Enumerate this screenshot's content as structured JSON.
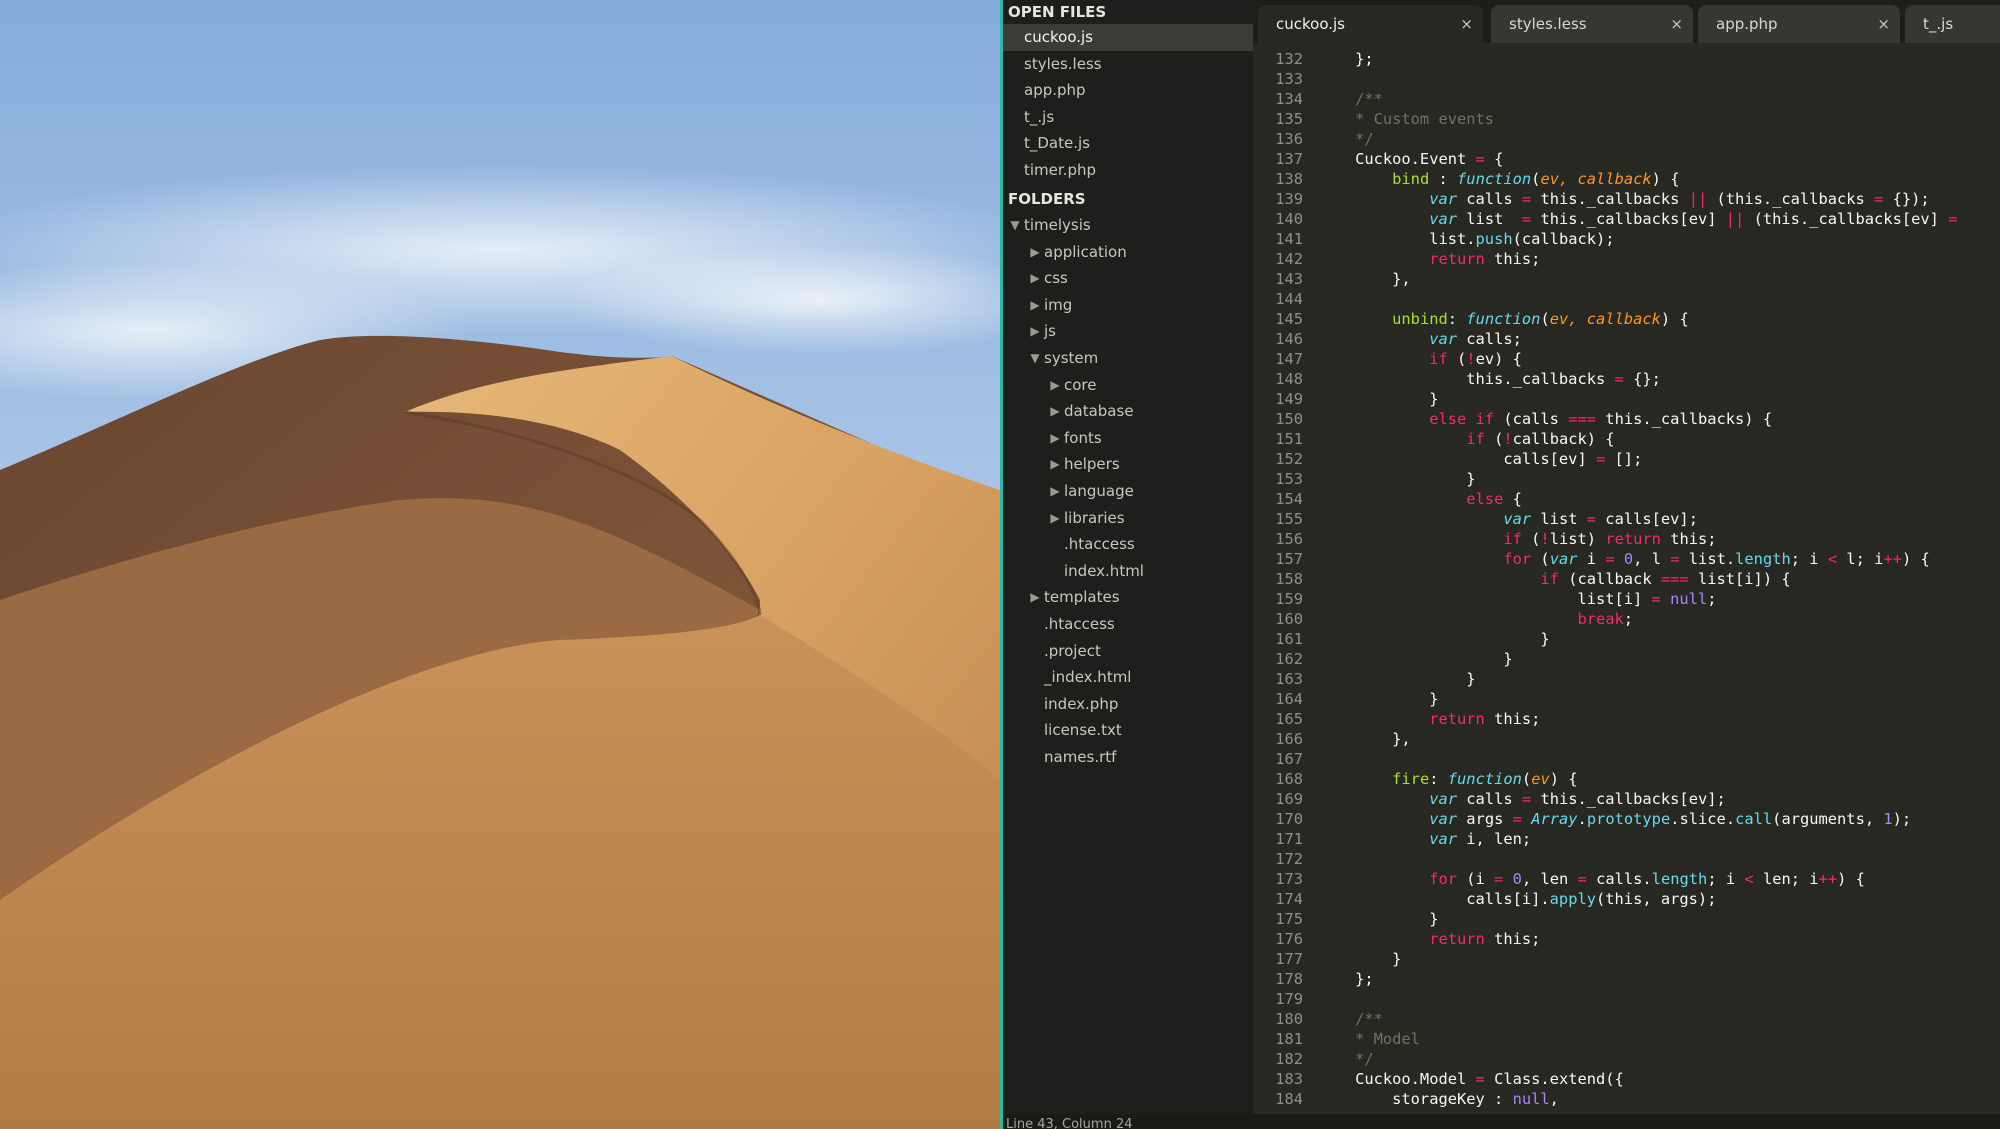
{
  "wallpaper": {
    "description_icon": "desert-dune-wallpaper"
  },
  "sidebar": {
    "open_files_header": "OPEN FILES",
    "open_files": [
      {
        "label": "cuckoo.js",
        "active": true
      },
      {
        "label": "styles.less"
      },
      {
        "label": "app.php"
      },
      {
        "label": "t_.js"
      },
      {
        "label": "t_Date.js"
      },
      {
        "label": "timer.php"
      }
    ],
    "folders_header": "FOLDERS",
    "tree": [
      {
        "label": "timelysis",
        "depth": 0,
        "arrow": "open"
      },
      {
        "label": "application",
        "depth": 1,
        "arrow": "closed"
      },
      {
        "label": "css",
        "depth": 1,
        "arrow": "closed"
      },
      {
        "label": "img",
        "depth": 1,
        "arrow": "closed"
      },
      {
        "label": "js",
        "depth": 1,
        "arrow": "closed"
      },
      {
        "label": "system",
        "depth": 1,
        "arrow": "open"
      },
      {
        "label": "core",
        "depth": 2,
        "arrow": "closed"
      },
      {
        "label": "database",
        "depth": 2,
        "arrow": "closed"
      },
      {
        "label": "fonts",
        "depth": 2,
        "arrow": "closed"
      },
      {
        "label": "helpers",
        "depth": 2,
        "arrow": "closed"
      },
      {
        "label": "language",
        "depth": 2,
        "arrow": "closed"
      },
      {
        "label": "libraries",
        "depth": 2,
        "arrow": "closed"
      },
      {
        "label": ".htaccess",
        "depth": 2,
        "arrow": "none"
      },
      {
        "label": "index.html",
        "depth": 2,
        "arrow": "none"
      },
      {
        "label": "templates",
        "depth": 1,
        "arrow": "closed"
      },
      {
        "label": ".htaccess",
        "depth": 1,
        "arrow": "none"
      },
      {
        "label": ".project",
        "depth": 1,
        "arrow": "none"
      },
      {
        "label": "_index.html",
        "depth": 1,
        "arrow": "none"
      },
      {
        "label": "index.php",
        "depth": 1,
        "arrow": "none"
      },
      {
        "label": "license.txt",
        "depth": 1,
        "arrow": "none"
      },
      {
        "label": "names.rtf",
        "depth": 1,
        "arrow": "none"
      }
    ]
  },
  "tabs": [
    {
      "label": "cuckoo.js",
      "close": "×",
      "active": true
    },
    {
      "label": "styles.less",
      "close": "×"
    },
    {
      "label": "app.php",
      "close": "×"
    },
    {
      "label": "t_.js",
      "close": ""
    }
  ],
  "code_lines": [
    {
      "n": "132",
      "tokens": [
        [
          "    };",
          ""
        ]
      ]
    },
    {
      "n": "133",
      "tokens": []
    },
    {
      "n": "134",
      "tokens": [
        [
          "    /**",
          "cm"
        ]
      ]
    },
    {
      "n": "135",
      "tokens": [
        [
          "    * Custom events",
          "cm"
        ]
      ]
    },
    {
      "n": "136",
      "tokens": [
        [
          "    */",
          "cm"
        ]
      ]
    },
    {
      "n": "137",
      "tokens": [
        [
          "    Cuckoo.Event ",
          ""
        ],
        [
          "=",
          "kw"
        ],
        [
          " {",
          ""
        ]
      ]
    },
    {
      "n": "138",
      "tokens": [
        [
          "        ",
          ""
        ],
        [
          "bind",
          "fn"
        ],
        [
          " : ",
          ""
        ],
        [
          "function",
          "st"
        ],
        [
          "(",
          ""
        ],
        [
          "ev, callback",
          "pa"
        ],
        [
          ") {",
          ""
        ]
      ]
    },
    {
      "n": "139",
      "tokens": [
        [
          "            ",
          ""
        ],
        [
          "var",
          "st"
        ],
        [
          " calls ",
          ""
        ],
        [
          "=",
          "kw"
        ],
        [
          " this._callbacks ",
          ""
        ],
        [
          "||",
          "kw"
        ],
        [
          " (this._callbacks ",
          ""
        ],
        [
          "=",
          "kw"
        ],
        [
          " {});",
          ""
        ]
      ]
    },
    {
      "n": "140",
      "tokens": [
        [
          "            ",
          ""
        ],
        [
          "var",
          "st"
        ],
        [
          " list  ",
          ""
        ],
        [
          "=",
          "kw"
        ],
        [
          " this._callbacks[ev] ",
          ""
        ],
        [
          "||",
          "kw"
        ],
        [
          " (this._callbacks[ev] ",
          ""
        ],
        [
          "=",
          "kw"
        ]
      ]
    },
    {
      "n": "141",
      "tokens": [
        [
          "            list.",
          ""
        ],
        [
          "push",
          "bi"
        ],
        [
          "(callback);",
          ""
        ]
      ]
    },
    {
      "n": "142",
      "tokens": [
        [
          "            ",
          ""
        ],
        [
          "return",
          "kw"
        ],
        [
          " this;",
          ""
        ]
      ]
    },
    {
      "n": "143",
      "tokens": [
        [
          "        },",
          ""
        ]
      ]
    },
    {
      "n": "144",
      "tokens": []
    },
    {
      "n": "145",
      "tokens": [
        [
          "        ",
          ""
        ],
        [
          "unbind",
          "fn"
        ],
        [
          ": ",
          ""
        ],
        [
          "function",
          "st"
        ],
        [
          "(",
          ""
        ],
        [
          "ev, callback",
          "pa"
        ],
        [
          ") {",
          ""
        ]
      ]
    },
    {
      "n": "146",
      "tokens": [
        [
          "            ",
          ""
        ],
        [
          "var",
          "st"
        ],
        [
          " calls;",
          ""
        ]
      ]
    },
    {
      "n": "147",
      "tokens": [
        [
          "            ",
          ""
        ],
        [
          "if",
          "kw"
        ],
        [
          " (",
          ""
        ],
        [
          "!",
          "kw"
        ],
        [
          "ev) {",
          ""
        ]
      ]
    },
    {
      "n": "148",
      "tokens": [
        [
          "                this._callbacks ",
          ""
        ],
        [
          "=",
          "kw"
        ],
        [
          " {};",
          ""
        ]
      ]
    },
    {
      "n": "149",
      "tokens": [
        [
          "            }",
          ""
        ]
      ]
    },
    {
      "n": "150",
      "tokens": [
        [
          "            ",
          ""
        ],
        [
          "else if",
          "kw"
        ],
        [
          " (calls ",
          ""
        ],
        [
          "===",
          "kw"
        ],
        [
          " this._callbacks) {",
          ""
        ]
      ]
    },
    {
      "n": "151",
      "tokens": [
        [
          "                ",
          ""
        ],
        [
          "if",
          "kw"
        ],
        [
          " (",
          ""
        ],
        [
          "!",
          "kw"
        ],
        [
          "callback) {",
          ""
        ]
      ]
    },
    {
      "n": "152",
      "tokens": [
        [
          "                    calls[ev] ",
          ""
        ],
        [
          "=",
          "kw"
        ],
        [
          " [];",
          ""
        ]
      ]
    },
    {
      "n": "153",
      "tokens": [
        [
          "                }",
          ""
        ]
      ]
    },
    {
      "n": "154",
      "tokens": [
        [
          "                ",
          ""
        ],
        [
          "else",
          "kw"
        ],
        [
          " {",
          ""
        ]
      ]
    },
    {
      "n": "155",
      "tokens": [
        [
          "                    ",
          ""
        ],
        [
          "var",
          "st"
        ],
        [
          " list ",
          ""
        ],
        [
          "=",
          "kw"
        ],
        [
          " calls[ev];",
          ""
        ]
      ]
    },
    {
      "n": "156",
      "tokens": [
        [
          "                    ",
          ""
        ],
        [
          "if",
          "kw"
        ],
        [
          " (",
          ""
        ],
        [
          "!",
          "kw"
        ],
        [
          "list) ",
          ""
        ],
        [
          "return",
          "kw"
        ],
        [
          " this;",
          ""
        ]
      ]
    },
    {
      "n": "157",
      "tokens": [
        [
          "                    ",
          ""
        ],
        [
          "for",
          "kw"
        ],
        [
          " (",
          ""
        ],
        [
          "var",
          "st"
        ],
        [
          " i ",
          ""
        ],
        [
          "=",
          "kw"
        ],
        [
          " ",
          ""
        ],
        [
          "0",
          "nu"
        ],
        [
          ", l ",
          ""
        ],
        [
          "=",
          "kw"
        ],
        [
          " list.",
          ""
        ],
        [
          "length",
          "bi"
        ],
        [
          "; i ",
          ""
        ],
        [
          "<",
          "kw"
        ],
        [
          " l; i",
          ""
        ],
        [
          "++",
          "kw"
        ],
        [
          ") {",
          ""
        ]
      ]
    },
    {
      "n": "158",
      "tokens": [
        [
          "                        ",
          ""
        ],
        [
          "if",
          "kw"
        ],
        [
          " (callback ",
          ""
        ],
        [
          "===",
          "kw"
        ],
        [
          " list[i]) {",
          ""
        ]
      ]
    },
    {
      "n": "159",
      "tokens": [
        [
          "                            list[i] ",
          ""
        ],
        [
          "=",
          "kw"
        ],
        [
          " ",
          ""
        ],
        [
          "null",
          "nu"
        ],
        [
          ";",
          ""
        ]
      ]
    },
    {
      "n": "160",
      "tokens": [
        [
          "                            ",
          ""
        ],
        [
          "break",
          "kw"
        ],
        [
          ";",
          ""
        ]
      ]
    },
    {
      "n": "161",
      "tokens": [
        [
          "                        }",
          ""
        ]
      ]
    },
    {
      "n": "162",
      "tokens": [
        [
          "                    }",
          ""
        ]
      ]
    },
    {
      "n": "163",
      "tokens": [
        [
          "                }",
          ""
        ]
      ]
    },
    {
      "n": "164",
      "tokens": [
        [
          "            }",
          ""
        ]
      ]
    },
    {
      "n": "165",
      "tokens": [
        [
          "            ",
          ""
        ],
        [
          "return",
          "kw"
        ],
        [
          " this;",
          ""
        ]
      ]
    },
    {
      "n": "166",
      "tokens": [
        [
          "        },",
          ""
        ]
      ]
    },
    {
      "n": "167",
      "tokens": []
    },
    {
      "n": "168",
      "tokens": [
        [
          "        ",
          ""
        ],
        [
          "fire",
          "fn"
        ],
        [
          ": ",
          ""
        ],
        [
          "function",
          "st"
        ],
        [
          "(",
          ""
        ],
        [
          "ev",
          "pa"
        ],
        [
          ") {",
          ""
        ]
      ]
    },
    {
      "n": "169",
      "tokens": [
        [
          "            ",
          ""
        ],
        [
          "var",
          "st"
        ],
        [
          " calls ",
          ""
        ],
        [
          "=",
          "kw"
        ],
        [
          " this._callbacks[ev];",
          ""
        ]
      ]
    },
    {
      "n": "170",
      "tokens": [
        [
          "            ",
          ""
        ],
        [
          "var",
          "st"
        ],
        [
          " args ",
          ""
        ],
        [
          "=",
          "kw"
        ],
        [
          " ",
          ""
        ],
        [
          "Array",
          "st"
        ],
        [
          ".",
          ""
        ],
        [
          "prototype",
          "bi"
        ],
        [
          ".slice.",
          ""
        ],
        [
          "call",
          "bi"
        ],
        [
          "(arguments, ",
          ""
        ],
        [
          "1",
          "nu"
        ],
        [
          ");",
          ""
        ]
      ]
    },
    {
      "n": "171",
      "tokens": [
        [
          "            ",
          ""
        ],
        [
          "var",
          "st"
        ],
        [
          " i, len;",
          ""
        ]
      ]
    },
    {
      "n": "172",
      "tokens": []
    },
    {
      "n": "173",
      "tokens": [
        [
          "            ",
          ""
        ],
        [
          "for",
          "kw"
        ],
        [
          " (i ",
          ""
        ],
        [
          "=",
          "kw"
        ],
        [
          " ",
          ""
        ],
        [
          "0",
          "nu"
        ],
        [
          ", len ",
          ""
        ],
        [
          "=",
          "kw"
        ],
        [
          " calls.",
          ""
        ],
        [
          "length",
          "bi"
        ],
        [
          "; i ",
          ""
        ],
        [
          "<",
          "kw"
        ],
        [
          " len; i",
          ""
        ],
        [
          "++",
          "kw"
        ],
        [
          ") {",
          ""
        ]
      ]
    },
    {
      "n": "174",
      "tokens": [
        [
          "                calls[i].",
          ""
        ],
        [
          "apply",
          "bi"
        ],
        [
          "(this, args);",
          ""
        ]
      ]
    },
    {
      "n": "175",
      "tokens": [
        [
          "            }",
          ""
        ]
      ]
    },
    {
      "n": "176",
      "tokens": [
        [
          "            ",
          ""
        ],
        [
          "return",
          "kw"
        ],
        [
          " this;",
          ""
        ]
      ]
    },
    {
      "n": "177",
      "tokens": [
        [
          "        }",
          ""
        ]
      ]
    },
    {
      "n": "178",
      "tokens": [
        [
          "    };",
          ""
        ]
      ]
    },
    {
      "n": "179",
      "tokens": []
    },
    {
      "n": "180",
      "tokens": [
        [
          "    /**",
          "cm"
        ]
      ]
    },
    {
      "n": "181",
      "tokens": [
        [
          "    * Model",
          "cm"
        ]
      ]
    },
    {
      "n": "182",
      "tokens": [
        [
          "    */",
          "cm"
        ]
      ]
    },
    {
      "n": "183",
      "tokens": [
        [
          "    Cuckoo.Model ",
          ""
        ],
        [
          "=",
          "kw"
        ],
        [
          " Class.extend({",
          ""
        ]
      ]
    },
    {
      "n": "184",
      "tokens": [
        [
          "        storageKey : ",
          ""
        ],
        [
          "null",
          "nu"
        ],
        [
          ",",
          ""
        ]
      ]
    }
  ],
  "status": {
    "text": "Line 43, Column 24"
  },
  "colors": {
    "editor_bg": "#272822",
    "sidebar_bg": "#1e1f1c",
    "tabbar_bg": "#1d1e1a",
    "divider": "#2fb8a4",
    "keyword": "#f92672",
    "storage": "#66d9ef",
    "function_name": "#a6e22e",
    "parameter": "#fd971f",
    "number": "#ae81ff",
    "comment": "#75715e",
    "builtin": "#66d9ef",
    "text": "#f8f8f2"
  }
}
